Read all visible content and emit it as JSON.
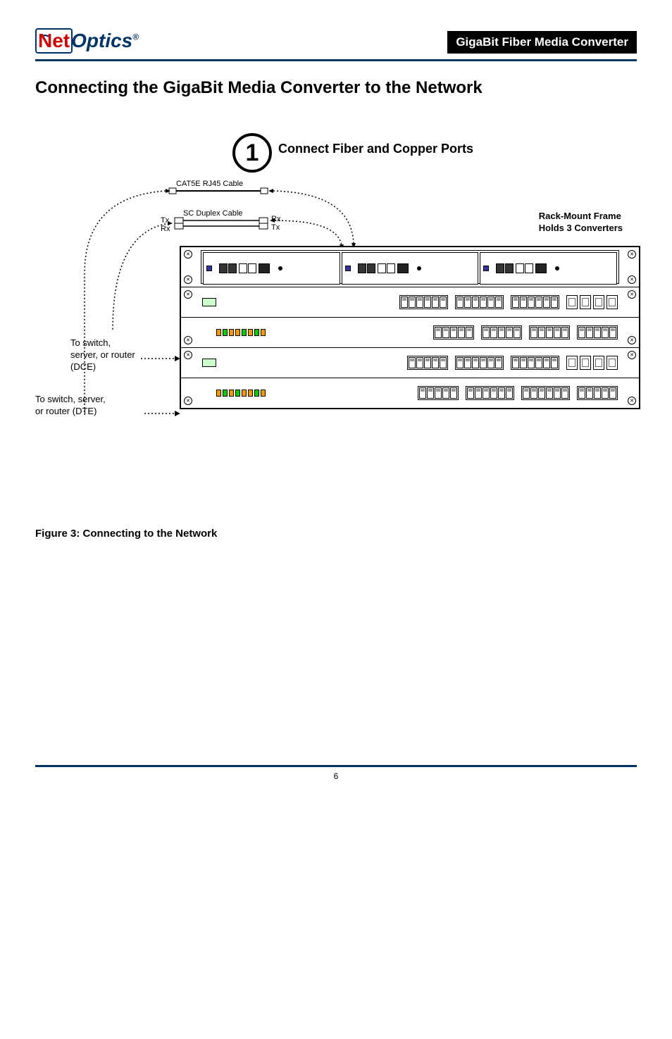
{
  "header": {
    "logo_net": "Net",
    "logo_optics": "Optics",
    "logo_reg": "®",
    "title_banner": "GigaBit Fiber Media Converter"
  },
  "section_title": "Connecting the GigaBit Media Converter to the Network",
  "step": {
    "number": "1",
    "label": "Connect Fiber and Copper Ports"
  },
  "cables": {
    "cat5e": "CAT5E RJ45 Cable",
    "sc_duplex": "SC Duplex Cable",
    "tx": "Tx",
    "rx": "Rx"
  },
  "rack_label_line1": "Rack-Mount Frame",
  "rack_label_line2": "Holds 3 Converters",
  "side_labels": {
    "dce_line1": "To switch,",
    "dce_line2": "server, or router",
    "dce_line3": "(DCE)",
    "dte_line1": "To switch, server,",
    "dte_line2": "or router (DTE)"
  },
  "figure": {
    "num": "Figure 3:",
    "text": "Connecting to the Network"
  },
  "page_number": "6"
}
